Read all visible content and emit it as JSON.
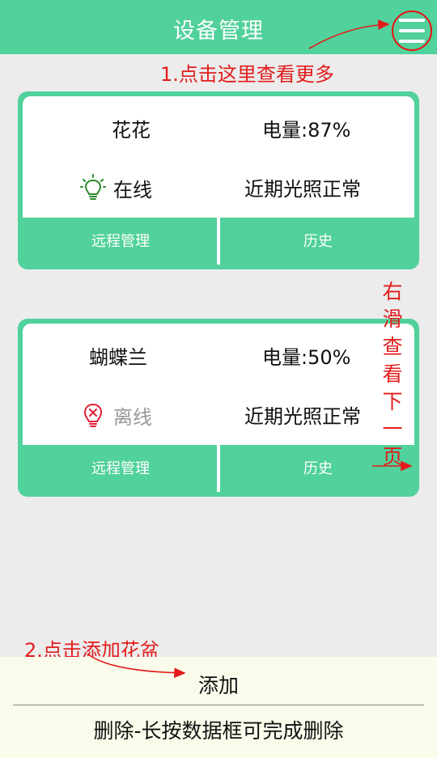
{
  "header": {
    "title": "设备管理"
  },
  "annotations": {
    "menu_hint": "1.点击这里查看更多",
    "swipe_hint": "右滑查看下一页",
    "add_hint": "2.点击添加花盆"
  },
  "devices": [
    {
      "name": "花花",
      "battery": "电量:87%",
      "status": "在线",
      "status_icon": "bulb-online-icon",
      "light": "近期光照正常",
      "remote_label": "远程管理",
      "history_label": "历史"
    },
    {
      "name": "蝴蝶兰",
      "battery": "电量:50%",
      "status": "离线",
      "status_icon": "bulb-offline-icon",
      "light": "近期光照正常",
      "remote_label": "远程管理",
      "history_label": "历史"
    }
  ],
  "bottom": {
    "add_label": "添加",
    "delete_label": "删除-长按数据框可完成删除"
  },
  "colors": {
    "accent": "#51d19b",
    "annotation": "#e21c1c",
    "online_icon": "#2a8a2a",
    "offline_icon": "#e0203a",
    "bottom_bg": "#fbfbec"
  }
}
